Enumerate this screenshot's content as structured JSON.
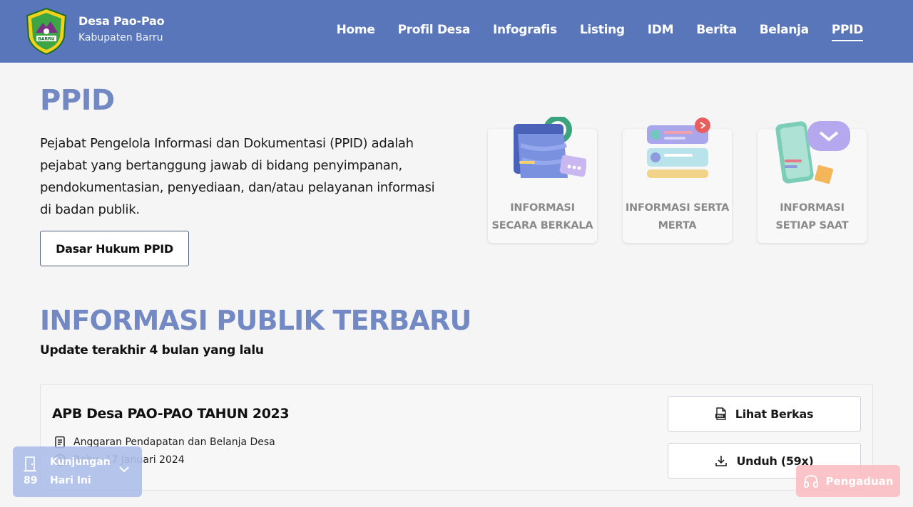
{
  "header": {
    "brand_name": "Desa Pao-Pao",
    "brand_sub": "Kabupaten Barru",
    "logo_text": "BARRU",
    "nav": [
      "Home",
      "Profil Desa",
      "Infografis",
      "Listing",
      "IDM",
      "Berita",
      "Belanja",
      "PPID"
    ],
    "active_nav": "PPID"
  },
  "ppid": {
    "title": "PPID",
    "description": "Pejabat Pengelola Informasi dan Dokumentasi (PPID) adalah pejabat yang bertanggung jawab di bidang penyimpanan, pendokumentasian, penyediaan, dan/atau pelayanan informasi di badan publik.",
    "button": "Dasar Hukum PPID",
    "cards": [
      {
        "line1": "INFORMASI",
        "line2": "SECARA BERKALA",
        "icon": "folder-icon"
      },
      {
        "line1": "INFORMASI SERTA",
        "line2": "MERTA",
        "icon": "list-alert-icon"
      },
      {
        "line1": "INFORMASI",
        "line2": "SETIAP SAAT",
        "icon": "phone-message-icon"
      }
    ]
  },
  "public_info": {
    "title": "INFORMASI PUBLIK TERBARU",
    "subtitle": "Update terakhir 4 bulan yang lalu",
    "documents": [
      {
        "title": "APB Desa PAO-PAO TAHUN 2023",
        "category": "Anggaran Pendapatan dan Belanja Desa",
        "date": "Rabu, 17 Januari 2024",
        "view_label": "Lihat Berkas",
        "download_label": "Unduh (59x)"
      }
    ]
  },
  "widgets": {
    "visit_count": "89",
    "visit_line1": "Kunjungan",
    "visit_line2": "Hari Ini",
    "complaint_label": "Pengaduan"
  },
  "colors": {
    "header": "#5876b9",
    "title_accent": "#7389c4",
    "background": "#f5f5f6"
  }
}
